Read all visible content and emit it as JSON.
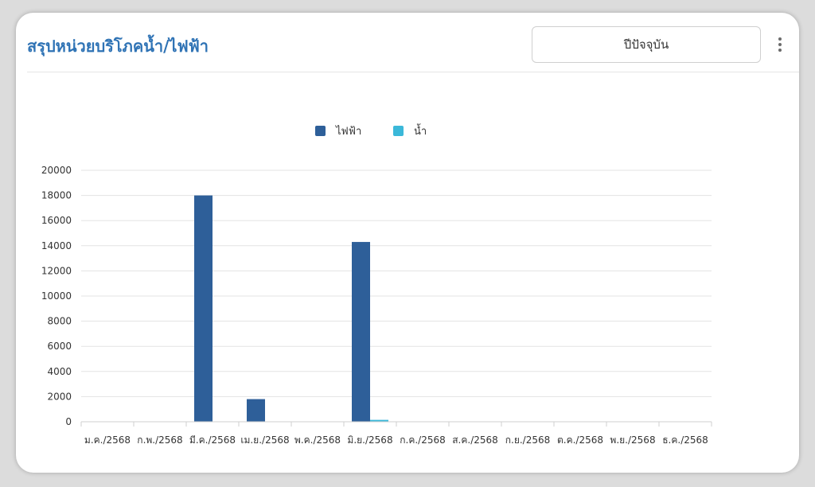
{
  "header": {
    "title": "สรุปหน่วยบริโภคน้ำ/ไฟฟ้า",
    "period_selected": "ปีปัจจุบัน",
    "menu_icon": "kebab-menu-icon"
  },
  "colors": {
    "title": "#2f73b5",
    "electricity": "#2e5f99",
    "water": "#3bb8d9"
  },
  "chart_data": {
    "type": "bar",
    "title": "",
    "xlabel": "",
    "ylabel": "",
    "categories": [
      "ม.ค./2568",
      "ก.พ./2568",
      "มี.ค./2568",
      "เม.ย./2568",
      "พ.ค./2568",
      "มิ.ย./2568",
      "ก.ค./2568",
      "ส.ค./2568",
      "ก.ย./2568",
      "ต.ค./2568",
      "พ.ย./2568",
      "ธ.ค./2568"
    ],
    "series": [
      {
        "name": "ไฟฟ้า",
        "values": [
          0,
          0,
          18000,
          1800,
          0,
          14300,
          0,
          0,
          0,
          0,
          0,
          0
        ]
      },
      {
        "name": "น้ำ",
        "values": [
          0,
          0,
          0,
          0,
          0,
          150,
          0,
          0,
          0,
          0,
          0,
          0
        ]
      }
    ],
    "ylim": [
      0,
      20000
    ],
    "yticks": [
      0,
      2000,
      4000,
      6000,
      8000,
      10000,
      12000,
      14000,
      16000,
      18000,
      20000
    ],
    "grid": true,
    "legend": "top-center"
  }
}
